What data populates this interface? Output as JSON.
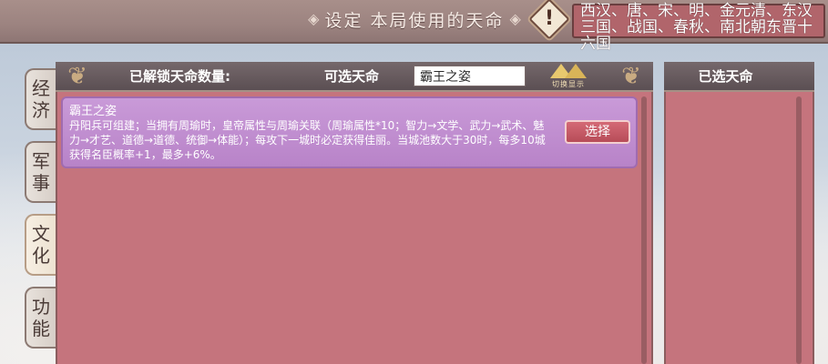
{
  "header": {
    "title": "设定 本局使用的天命",
    "era_list": "西汉、唐、宋、明、金元清、东汉三国、战国、春秋、南北朝东晋十六国"
  },
  "tabs": [
    {
      "label_1": "经",
      "label_2": "济"
    },
    {
      "label_1": "军",
      "label_2": "事"
    },
    {
      "label_1": "文",
      "label_2": "化"
    },
    {
      "label_1": "功",
      "label_2": "能"
    }
  ],
  "main": {
    "unlocked_label": "已解锁天命数量:",
    "available_label": "可选天命",
    "search_value": "霸王之姿",
    "switch_emblem_text": "切换显示",
    "items": [
      {
        "title": "霸王之姿",
        "description": "丹阳兵可组建；当拥有周瑜时，皇帝属性与周瑜关联（周瑜属性*10；智力→文学、武力→武术、魅力→才艺、道德→道德、统御→体能）；每攻下一城时必定获得佳丽。当城池数大于30时，每多10城获得名臣概率+1，最多+6%。",
        "button": "选择"
      }
    ]
  },
  "right": {
    "title": "已选天命"
  },
  "colors": {
    "panel": "#c5747d",
    "card": "#c99ad8",
    "header": "#5b4f53",
    "button": "#c85a66"
  }
}
